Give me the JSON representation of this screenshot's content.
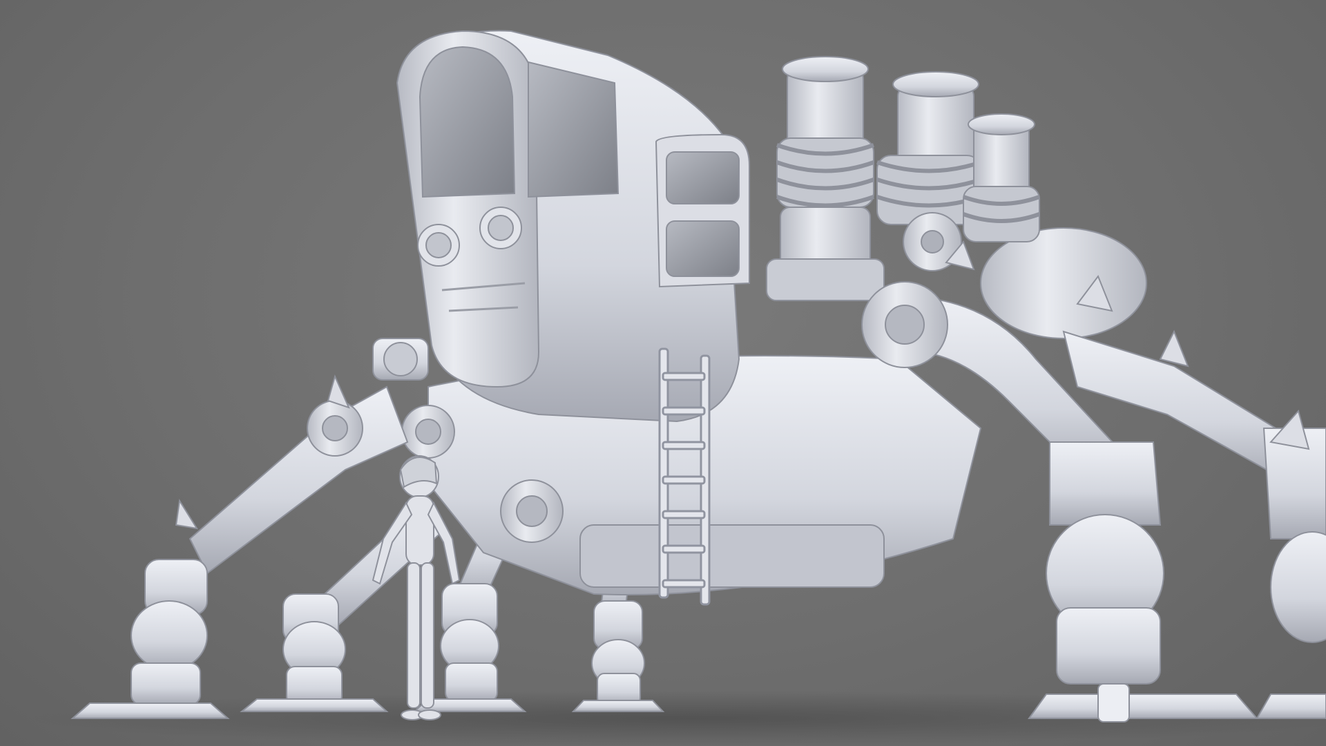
{
  "scene": {
    "subject": "walker-mech",
    "colors": {
      "background": "#6f6f6f",
      "clay": "#d6d8e0",
      "clay_light": "#eceef3",
      "clay_shade": "#a9acb6",
      "clay_dark": "#878a94",
      "glass": "#8a8d94",
      "shadow": "#4c4c4c"
    },
    "icons": [
      "cockpit-pod",
      "engine-cylinder",
      "ladder",
      "mech-leg",
      "human-figure"
    ]
  }
}
